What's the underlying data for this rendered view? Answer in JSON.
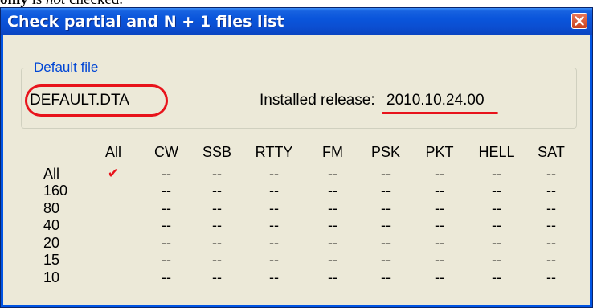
{
  "document": {
    "word_only": "only",
    "word_is": "is",
    "word_not": "not",
    "word_checked": "checked."
  },
  "window": {
    "title": "Check partial and N + 1 files list",
    "close_icon": "close-icon"
  },
  "default_file": {
    "group_label": "Default file",
    "file_name": "DEFAULT.DTA",
    "installed_label": "Installed release:",
    "installed_value": "2010.10.24.00"
  },
  "grid": {
    "columns": [
      "All",
      "CW",
      "SSB",
      "RTTY",
      "FM",
      "PSK",
      "PKT",
      "HELL",
      "SAT"
    ],
    "rows": [
      "All",
      "160",
      "80",
      "40",
      "20",
      "15",
      "10"
    ],
    "checked_cell": {
      "row": "All",
      "column": "All",
      "mark": "✔"
    },
    "empty_mark": "--"
  },
  "colors": {
    "annotation": "#e8131b",
    "titlebar": "#0a55db",
    "client": "#ece9d8",
    "group_title": "#0046d5"
  }
}
